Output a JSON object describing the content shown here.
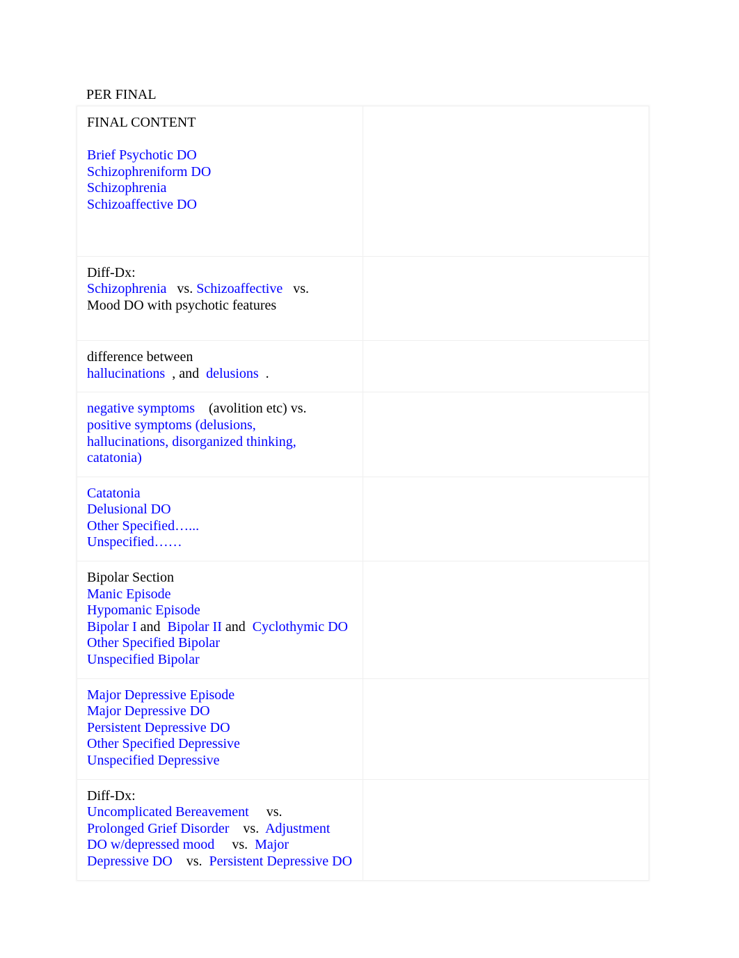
{
  "document": {
    "title": "PER FINAL"
  },
  "colors": {
    "link": "#0000FF",
    "text": "#000000",
    "border": "#EFEFEF",
    "background": "#FFFFFF"
  },
  "table": {
    "columns": 2,
    "right_column_label": "",
    "rows": [
      {
        "id": "row-final-content",
        "left": {
          "lines": [
            {
              "segments": [
                {
                  "text": "FINAL CONTENT",
                  "style": "text"
                }
              ]
            },
            {
              "segments": [
                {
                  "text": "",
                  "style": "text"
                }
              ]
            },
            {
              "segments": [
                {
                  "text": "Brief Psychotic DO",
                  "style": "link"
                }
              ]
            },
            {
              "segments": [
                {
                  "text": "Schizophreniform DO",
                  "style": "link"
                }
              ]
            },
            {
              "segments": [
                {
                  "text": "Schizophrenia",
                  "style": "link"
                }
              ]
            },
            {
              "segments": [
                {
                  "text": "Schizoaffective DO",
                  "style": "link"
                }
              ]
            },
            {
              "segments": [
                {
                  "text": "",
                  "style": "text"
                }
              ]
            },
            {
              "segments": [
                {
                  "text": "",
                  "style": "text"
                }
              ]
            }
          ]
        },
        "right": {
          "lines": []
        }
      },
      {
        "id": "row-diffdx-schizo",
        "left": {
          "lines": [
            {
              "segments": [
                {
                  "text": "Diff-Dx:",
                  "style": "text"
                }
              ]
            },
            {
              "segments": [
                {
                  "text": "Schizophrenia",
                  "style": "link"
                },
                {
                  "text": "   vs. ",
                  "style": "text"
                },
                {
                  "text": "Schizoaffective",
                  "style": "link"
                },
                {
                  "text": "   vs.",
                  "style": "text"
                }
              ]
            },
            {
              "segments": [
                {
                  "text": "Mood DO with psychotic features",
                  "style": "text"
                }
              ]
            },
            {
              "segments": [
                {
                  "text": "",
                  "style": "text"
                }
              ]
            }
          ]
        },
        "right": {
          "lines": []
        }
      },
      {
        "id": "row-hallucinations-delusions",
        "left": {
          "lines": [
            {
              "segments": [
                {
                  "text": "difference between",
                  "style": "text"
                }
              ]
            },
            {
              "segments": [
                {
                  "text": "hallucinations",
                  "style": "link"
                },
                {
                  "text": "  , and  ",
                  "style": "text"
                },
                {
                  "text": "delusions",
                  "style": "link"
                },
                {
                  "text": "  .",
                  "style": "text"
                }
              ]
            }
          ]
        },
        "right": {
          "lines": []
        }
      },
      {
        "id": "row-negative-positive-symptoms",
        "left": {
          "lines": [
            {
              "segments": [
                {
                  "text": "negative symptoms",
                  "style": "link"
                },
                {
                  "text": "    (avolition etc) vs.",
                  "style": "text"
                }
              ]
            },
            {
              "segments": [
                {
                  "text": "positive symptoms (delusions,",
                  "style": "link"
                }
              ]
            },
            {
              "segments": [
                {
                  "text": "hallucinations, disorganized thinking,",
                  "style": "link"
                }
              ]
            },
            {
              "segments": [
                {
                  "text": "catatonia)",
                  "style": "link"
                }
              ]
            }
          ]
        },
        "right": {
          "lines": []
        }
      },
      {
        "id": "row-catatonia-delusional",
        "left": {
          "lines": [
            {
              "segments": [
                {
                  "text": "Catatonia",
                  "style": "link"
                }
              ]
            },
            {
              "segments": [
                {
                  "text": "Delusional DO",
                  "style": "link"
                }
              ]
            },
            {
              "segments": [
                {
                  "text": "Other Specified…...",
                  "style": "link"
                }
              ]
            },
            {
              "segments": [
                {
                  "text": "Unspecified……",
                  "style": "link"
                }
              ]
            }
          ]
        },
        "right": {
          "lines": []
        }
      },
      {
        "id": "row-bipolar-section",
        "left": {
          "lines": [
            {
              "segments": [
                {
                  "text": "Bipolar Section",
                  "style": "text"
                }
              ]
            },
            {
              "segments": [
                {
                  "text": "Manic Episode",
                  "style": "link"
                }
              ]
            },
            {
              "segments": [
                {
                  "text": "Hypomanic Episode",
                  "style": "link"
                }
              ]
            },
            {
              "segments": [
                {
                  "text": "Bipolar I",
                  "style": "link"
                },
                {
                  "text": " and  ",
                  "style": "text"
                },
                {
                  "text": "Bipolar II",
                  "style": "link"
                },
                {
                  "text": " and  ",
                  "style": "text"
                },
                {
                  "text": "Cyclothymic DO",
                  "style": "link"
                }
              ]
            },
            {
              "segments": [
                {
                  "text": "Other Specified Bipolar",
                  "style": "link"
                }
              ]
            },
            {
              "segments": [
                {
                  "text": "Unspecified Bipolar",
                  "style": "link"
                }
              ]
            }
          ]
        },
        "right": {
          "lines": []
        }
      },
      {
        "id": "row-depressive-section",
        "left": {
          "lines": [
            {
              "segments": [
                {
                  "text": "Major Depressive Episode",
                  "style": "link"
                }
              ]
            },
            {
              "segments": [
                {
                  "text": "Major Depressive DO",
                  "style": "link"
                }
              ]
            },
            {
              "segments": [
                {
                  "text": "Persistent Depressive DO",
                  "style": "link"
                }
              ]
            },
            {
              "segments": [
                {
                  "text": "Other Specified Depressive",
                  "style": "link"
                }
              ]
            },
            {
              "segments": [
                {
                  "text": "Unspecified Depressive",
                  "style": "link"
                }
              ]
            }
          ]
        },
        "right": {
          "lines": []
        }
      },
      {
        "id": "row-diffdx-grief",
        "left": {
          "lines": [
            {
              "segments": [
                {
                  "text": "Diff-Dx:",
                  "style": "text"
                }
              ]
            },
            {
              "segments": [
                {
                  "text": "Uncomplicated Bereavement",
                  "style": "link"
                },
                {
                  "text": "     vs.",
                  "style": "text"
                }
              ]
            },
            {
              "segments": [
                {
                  "text": "Prolonged Grief Disorder",
                  "style": "link"
                },
                {
                  "text": "    vs.  ",
                  "style": "text"
                },
                {
                  "text": "Adjustment DO w/depressed mood",
                  "style": "link"
                },
                {
                  "text": "     vs.  ",
                  "style": "text"
                },
                {
                  "text": "Major Depressive DO",
                  "style": "link"
                },
                {
                  "text": "    vs.  ",
                  "style": "text"
                },
                {
                  "text": "Persistent Depressive DO",
                  "style": "link"
                }
              ]
            }
          ]
        },
        "right": {
          "lines": []
        }
      }
    ]
  }
}
